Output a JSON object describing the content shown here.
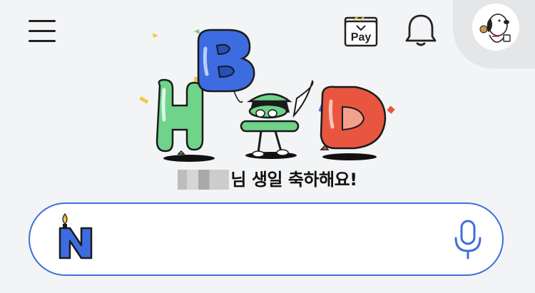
{
  "header": {
    "menu_icon": "hamburger-menu-icon",
    "pay_icon": "pay-wallet-icon",
    "pay_label": "Pay",
    "bell_icon": "bell-icon",
    "avatar_icon": "snoopy-avatar"
  },
  "banner": {
    "letters": [
      "H",
      "B",
      "D"
    ],
    "balloon_colors": [
      "#6fd38a",
      "#3d6be0",
      "#e9563f"
    ],
    "greeting_suffix": "님 생일 축하해요!",
    "name_blurred": true
  },
  "search": {
    "logo_icon": "naver-n-candle-logo",
    "accent_color": "#3f6fd8",
    "value": "",
    "mic_icon": "microphone-icon"
  }
}
